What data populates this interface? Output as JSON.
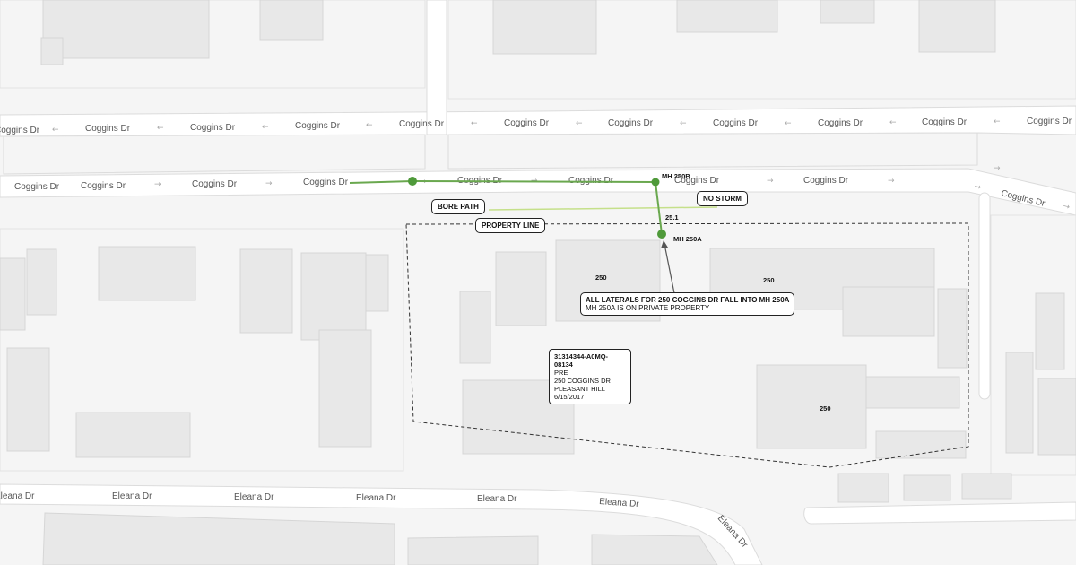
{
  "streets": {
    "coggins_label": "Coggins Dr",
    "eleana_label": "Eleana Dr",
    "arrow_left": "←",
    "arrow_right": "→"
  },
  "callouts": {
    "bore_path": "BORE PATH",
    "property_line": "PROPERTY LINE",
    "no_storm": "NO STORM",
    "laterals_title": "ALL LATERALS FOR 250 COGGINS DR FALL INTO MH 250A",
    "laterals_sub": "MH 250A IS ON PRIVATE PROPERTY"
  },
  "manholes": {
    "mh_250b": "MH 250B",
    "mh_250a": "MH 250A",
    "distance": "25.1"
  },
  "building_numbers": [
    "250",
    "250",
    "250"
  ],
  "info_box": {
    "id": "31314344-A0MQ-08134",
    "type": "PRE",
    "address": "250 COGGINS DR",
    "city": "PLEASANT HILL",
    "date": "6/15/2017"
  },
  "colors": {
    "background": "#f5f5f5",
    "road": "#ffffff",
    "building": "#e8e8e8",
    "building_stroke": "#d9d9d9",
    "sewer_line": "#6aa84f",
    "manhole": "#4f9a3a",
    "bore_path": "#c5e08a",
    "property_line": "#333333"
  }
}
